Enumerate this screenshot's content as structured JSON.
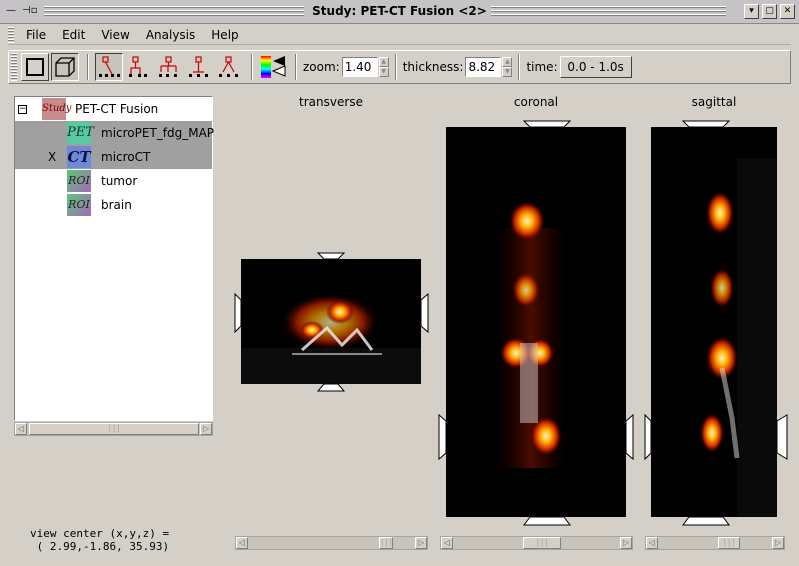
{
  "window": {
    "title": "Study: PET-CT Fusion <2>",
    "sys_left": "—",
    "sys_pin": "⊣▫",
    "btn_minimize": "▾",
    "btn_maximize": "▢",
    "btn_close": "✕"
  },
  "menu": [
    {
      "label": "File"
    },
    {
      "label": "Edit"
    },
    {
      "label": "View"
    },
    {
      "label": "Analysis"
    },
    {
      "label": "Help"
    }
  ],
  "toolbar": {
    "zoom_label": "zoom:",
    "zoom_value": "1.40",
    "thickness_label": "thickness:",
    "thickness_value": "8.82",
    "time_label": "time:",
    "time_value": "0.0 -   1.0s"
  },
  "tree": {
    "expander": "−",
    "study": {
      "badge": "Study",
      "label": "PET-CT Fusion"
    },
    "items": [
      {
        "badge": "PET",
        "label": "microPET_fdg_MAP",
        "visible_mark": "",
        "selected": true
      },
      {
        "badge": "CT",
        "label": "microCT",
        "visible_mark": "X",
        "selected": true
      },
      {
        "badge": "ROI",
        "label": "tumor",
        "visible_mark": "",
        "selected": false
      },
      {
        "badge": "ROI",
        "label": "brain",
        "visible_mark": "",
        "selected": false
      }
    ]
  },
  "views": {
    "transverse_label": "transverse",
    "coronal_label": "coronal",
    "sagittal_label": "sagittal"
  },
  "scroll": {
    "left_arrow": "◁",
    "right_arrow": "▷",
    "thumb_grip": "┆┆┆"
  },
  "status": {
    "line1": "view center (x,y,z) =",
    "line2": "( 2.99,-1.86, 35.93)"
  }
}
